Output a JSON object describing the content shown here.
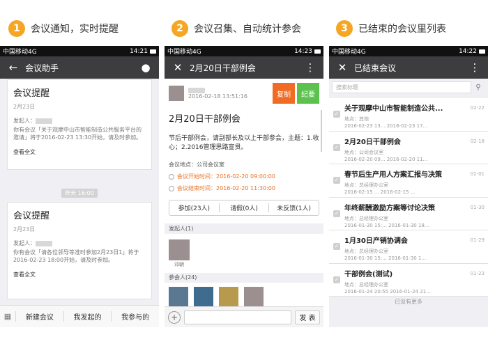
{
  "steps": [
    {
      "num": "1",
      "label": "会议通知，实时提醒"
    },
    {
      "num": "2",
      "label": "会议召集、自动统计参会"
    },
    {
      "num": "3",
      "label": "已结束的会议里列表"
    }
  ],
  "statusbar": {
    "carrier": "中国移动4G",
    "times": [
      "14:21",
      "14:23",
      "14:22"
    ]
  },
  "phone1": {
    "title": "会议助手",
    "cards": [
      {
        "title": "会议提醒",
        "date": "2月23日",
        "initiator_label": "发起人：",
        "body": "你有会议「关于观摩中山市智能制造公共服务平台的邀请」将于2016-02-23 13:30开始，请及时参加。",
        "cta": "查看全文"
      },
      {
        "title": "会议提醒",
        "date": "2月23日",
        "initiator_label": "发起人：",
        "body": "你有会议「请各位领导等准时参加2月23日1」将于2016-02-23 18:00开始，请及时参加。",
        "cta": "查看全文"
      }
    ],
    "time_separator": "昨天 16:00",
    "tabs": [
      "新建会议",
      "我发起的",
      "我参与的"
    ]
  },
  "phone2": {
    "title": "2月20日干部例会",
    "meta_time": "2016-02-18 13:51:16",
    "copy_label": "复制",
    "note_label": "纪要",
    "meeting_title": "2月20日干部例会",
    "description": "节后干部例会，请副部长及以上干部参会，主题：1.收心；2.2016管理思路宣贯。",
    "location": "会议地点：公司会议室",
    "start": "会议开始时间：2016-02-20 09:00:00",
    "end": "会议结束时间：2016-02-20 11:30:00",
    "tabs": [
      "参加(23人)",
      "请假(0人)",
      "未反馈(1人)"
    ],
    "initiator_section": "发起人(1)",
    "initiator_name": "邓朝",
    "participants_section": "参会人(24)",
    "send_label": "发 表"
  },
  "phone3": {
    "title": "已结束会议",
    "search_placeholder": "搜索标题",
    "items": [
      {
        "title": "关于观摩中山市智能制造公共...",
        "location": "地点：其他",
        "datetime": "2016-02-23 13... 2016-02-23 17...",
        "date": "02-22"
      },
      {
        "title": "2月20日干部例会",
        "location": "地点：公司会议室",
        "datetime": "2016-02-20 09... 2016-02-20 11...",
        "date": "02-18"
      },
      {
        "title": "春节后生产用人方案汇报与决策",
        "location": "地点：总经理办公室",
        "datetime": "2016-02-15 ... 2016-02-15 ...",
        "date": "02-01"
      },
      {
        "title": "年终薪酬激励方案等讨论决策",
        "location": "地点：总经理办公室",
        "datetime": "2016-01-30 15:... 2016-01-30 18...",
        "date": "01-30"
      },
      {
        "title": "1月30日产销协调会",
        "location": "地点：总经理办公室",
        "datetime": "2016-01-30 15:... 2016-01-30 1...",
        "date": "01-29"
      },
      {
        "title": "干部例会(测试)",
        "location": "地点：总经理办公室",
        "datetime": "2016-01-24 20:55 2016-01-24 21...",
        "date": "01-23"
      }
    ],
    "no_more": "已没有更多"
  }
}
